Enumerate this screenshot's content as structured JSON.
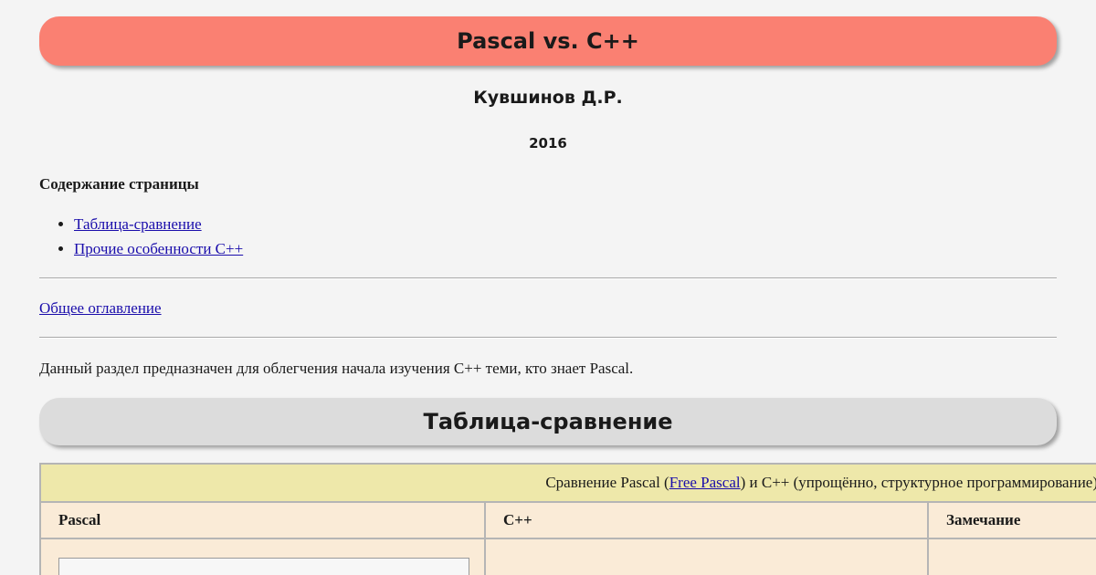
{
  "header": {
    "title": "Pascal vs. C++",
    "author": "Кувшинов Д.Р.",
    "year": "2016"
  },
  "toc": {
    "heading": "Содержание страницы",
    "items": [
      {
        "label": "Таблица-сравнение"
      },
      {
        "label": "Прочие особенности C++"
      }
    ],
    "general_link": "Общее оглавление"
  },
  "intro": "Данный раздел предназначен для облегчения начала изучения C++ теми, кто знает Pascal.",
  "section": {
    "title": "Таблица-сравнение"
  },
  "comparison_table": {
    "caption_before": "Сравнение Pascal (",
    "caption_link": "Free Pascal",
    "caption_after": ") и C++ (упрощённо, структурное программирование)",
    "columns": [
      "Pascal",
      "C++",
      "Замечание"
    ]
  },
  "colors": {
    "title_banner": "#fa8072",
    "section_banner": "#dcdcdc",
    "caption_bg": "#eee8aa",
    "table_bg": "#faebd7",
    "link": "#1a0dab",
    "page_bg": "#f4f4f4"
  }
}
